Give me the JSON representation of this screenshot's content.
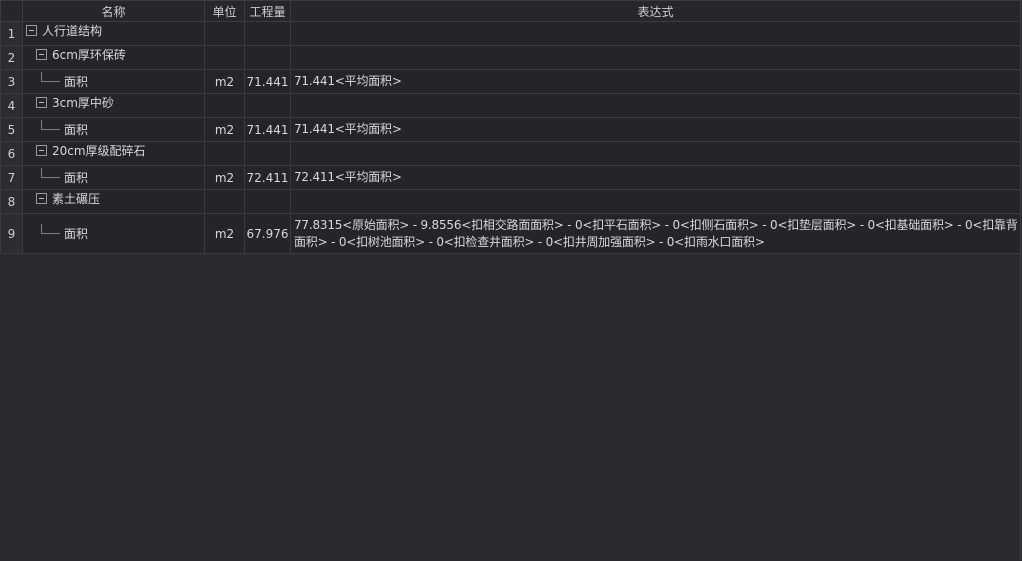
{
  "header": {
    "name": "名称",
    "unit": "单位",
    "qty": "工程量",
    "expr": "表达式"
  },
  "rows": [
    {
      "n": "1",
      "name": "人行道结构",
      "unit": "",
      "qty": "",
      "expr": ""
    },
    {
      "n": "2",
      "name": "6cm厚环保砖",
      "unit": "",
      "qty": "",
      "expr": ""
    },
    {
      "n": "3",
      "name": "面积",
      "unit": "m2",
      "qty": "71.441",
      "expr": "71.441<平均面积>"
    },
    {
      "n": "4",
      "name": "3cm厚中砂",
      "unit": "",
      "qty": "",
      "expr": ""
    },
    {
      "n": "5",
      "name": "面积",
      "unit": "m2",
      "qty": "71.441",
      "expr": "71.441<平均面积>"
    },
    {
      "n": "6",
      "name": "20cm厚级配碎石",
      "unit": "",
      "qty": "",
      "expr": ""
    },
    {
      "n": "7",
      "name": "面积",
      "unit": "m2",
      "qty": "72.411",
      "expr": "72.411<平均面积>"
    },
    {
      "n": "8",
      "name": "素土碾压",
      "unit": "",
      "qty": "",
      "expr": ""
    },
    {
      "n": "9",
      "name": "面积",
      "unit": "m2",
      "qty": "67.976",
      "expr": "77.8315<原始面积> - 9.8556<扣相交路面面积> - 0<扣平石面积> - 0<扣侧石面积> - 0<扣垫层面积> - 0<扣基础面积> - 0<扣靠背面积> - 0<扣树池面积> - 0<扣检查井面积> - 0<扣井周加强面积> - 0<扣雨水口面积>"
    }
  ]
}
